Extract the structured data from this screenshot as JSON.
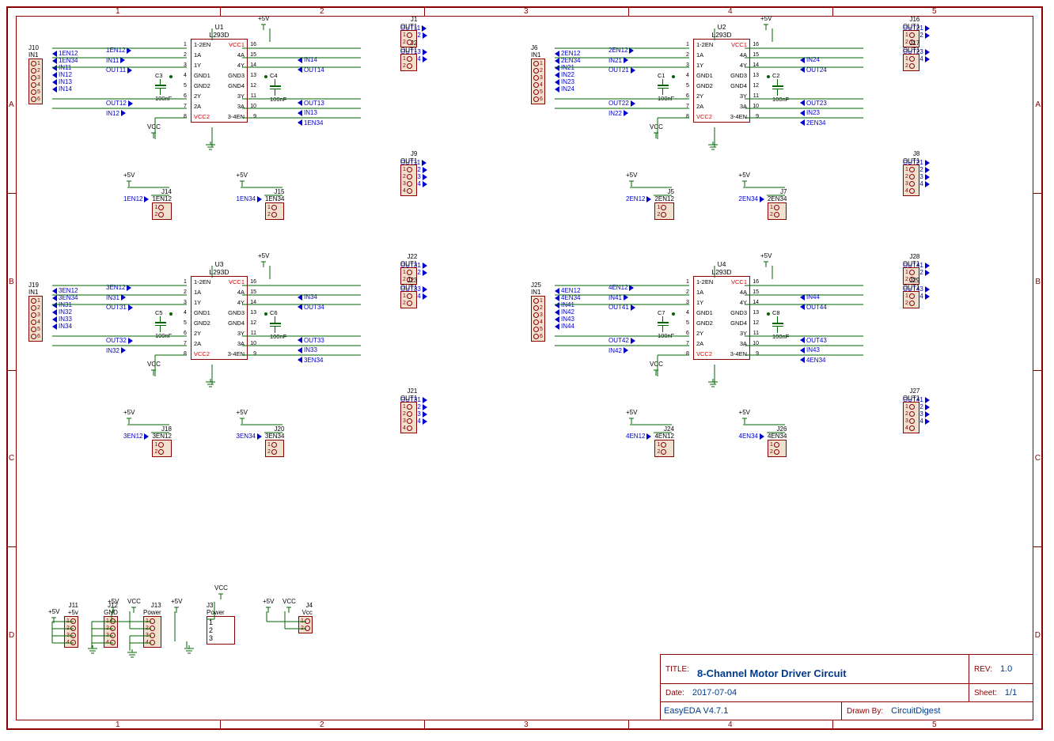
{
  "title_block": {
    "title_label": "TITLE:",
    "title": "8-Channel Motor Driver Circuit",
    "rev_label": "REV:",
    "rev": "1.0",
    "date_label": "Date:",
    "date": "2017-07-04",
    "sheet_label": "Sheet:",
    "sheet": "1/1",
    "tool": "EasyEDA V4.7.1",
    "drawn_label": "Drawn By:",
    "drawn": "CircuitDigest"
  },
  "grid": {
    "cols": [
      "1",
      "2",
      "3",
      "4",
      "5"
    ],
    "rows": [
      "A",
      "B",
      "C",
      "D"
    ]
  },
  "chip": {
    "part": "L293D",
    "pins_left": [
      "1-2EN",
      "1A",
      "1Y",
      "GND1",
      "GND2",
      "2Y",
      "2A",
      "VCC2"
    ],
    "pins_right": [
      "VCC1",
      "4A",
      "4Y",
      "GND3",
      "GND4",
      "3Y",
      "3A",
      "3-4EN"
    ],
    "nums_left": [
      "1",
      "2",
      "3",
      "4",
      "5",
      "6",
      "7",
      "8"
    ],
    "nums_right": [
      "16",
      "15",
      "14",
      "13",
      "12",
      "11",
      "10",
      "9"
    ]
  },
  "u_refs": [
    "U1",
    "U2",
    "U3",
    "U4"
  ],
  "caps": [
    {
      "ref": "C3",
      "val": "100nF"
    },
    {
      "ref": "C4",
      "val": "100nF"
    },
    {
      "ref": "C1",
      "val": "100nF"
    },
    {
      "ref": "C2",
      "val": "100nF"
    },
    {
      "ref": "C5",
      "val": "100nF"
    },
    {
      "ref": "C6",
      "val": "100nF"
    },
    {
      "ref": "C7",
      "val": "100nF"
    },
    {
      "ref": "C8",
      "val": "100nF"
    }
  ],
  "blocks": [
    {
      "idx": 1,
      "prefix": "1",
      "jin": "J10",
      "jout_pair1": "J1",
      "jout_pair2": "J2",
      "jout_all": "J9",
      "jen12": "J14",
      "jen34": "J15"
    },
    {
      "idx": 2,
      "prefix": "2",
      "jin": "J6",
      "jout_pair1": "J16",
      "jout_pair2": "J17",
      "jout_all": "J8",
      "jen12": "J5",
      "jen34": "J7"
    },
    {
      "idx": 3,
      "prefix": "3",
      "jin": "J19",
      "jout_pair1": "J22",
      "jout_pair2": "J23",
      "jout_all": "J21",
      "jen12": "J18",
      "jen34": "J20"
    },
    {
      "idx": 4,
      "prefix": "4",
      "jin": "J25",
      "jout_pair1": "J28",
      "jout_pair2": "J29",
      "jout_all": "J27",
      "jen12": "J24",
      "jen34": "J26"
    }
  ],
  "bottom_conns": [
    {
      "ref": "J11",
      "name": "+5v",
      "pins": 4
    },
    {
      "ref": "J12",
      "name": "GND",
      "pins": 4
    },
    {
      "ref": "J13",
      "name": "Power",
      "pins": 4
    },
    {
      "ref": "J3",
      "name": "Power",
      "pins": 3
    },
    {
      "ref": "J4",
      "name": "Vcc",
      "pins": 2
    }
  ],
  "nets": {
    "plus5V": "+5V",
    "vcc": "VCC",
    "in1": "IN1",
    "out1": "OUT1",
    "pwr": "Power",
    "gnd": "GND"
  },
  "labels": {
    "en12_suffix": "EN12",
    "en34_suffix": "EN34",
    "in_suffix": "IN",
    "out_suffix": "OUT"
  }
}
